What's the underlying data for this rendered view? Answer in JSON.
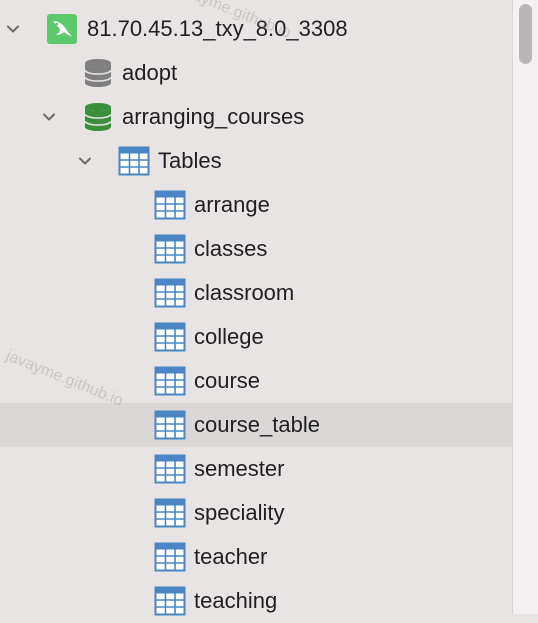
{
  "connection": {
    "label": "81.70.45.13_txy_8.0_3308",
    "icon": "mysql-dolphin-icon",
    "color": "#5cc96b"
  },
  "databases": [
    {
      "label": "adopt",
      "icon": "database-icon",
      "color": "#7f7f7f"
    },
    {
      "label": "arranging_courses",
      "icon": "database-icon",
      "color": "#3c8f3a"
    }
  ],
  "folder": {
    "label": "Tables",
    "icon": "table-icon",
    "color": "#4a86c5"
  },
  "tables": [
    {
      "label": "arrange"
    },
    {
      "label": "classes"
    },
    {
      "label": "classroom"
    },
    {
      "label": "college"
    },
    {
      "label": "course"
    },
    {
      "label": "course_table",
      "selected": true
    },
    {
      "label": "semester"
    },
    {
      "label": "speciality"
    },
    {
      "label": "teacher"
    },
    {
      "label": "teaching"
    }
  ],
  "watermark": {
    "text": "javayme.github.io"
  }
}
